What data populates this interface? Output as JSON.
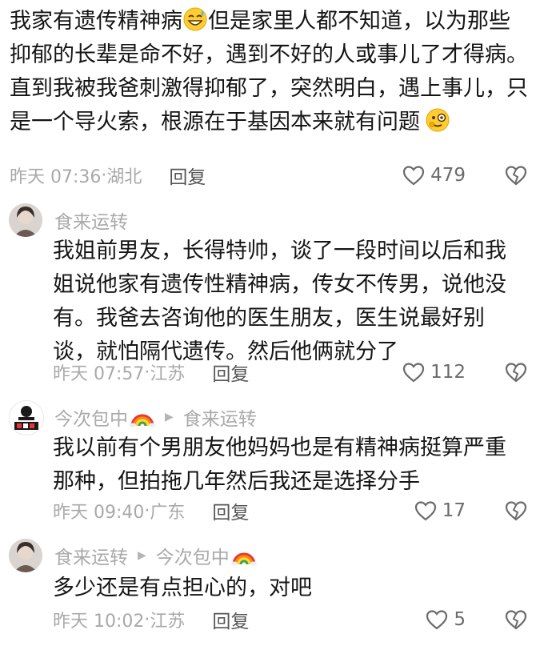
{
  "comments": [
    {
      "text_part1": "我家有遗传精神病",
      "text_part2": "但是家里人都不知道，以为那些抑郁的长辈是命不好，遇到不好的人或事儿了才得病。直到我被我爸刺激得抑郁了，突然明白，遇上事儿，只是一个导火索，根源在于基因本来就有问题",
      "emoji1": "sweat-smile-emoji",
      "emoji2": "monocle-emoji",
      "time": "昨天 07:36",
      "location": "湖北",
      "reply_label": "回复",
      "likes": "479"
    },
    {
      "author": "食来运转",
      "text": "我姐前男友，长得特帅，谈了一段时间以后和我姐说他家有遗传性精神病，传女不传男，说他没有。我爸去咨询他的医生朋友，医生说最好别谈，就怕隔代遗传。然后他俩就分了",
      "time": "昨天 07:57",
      "location": "江苏",
      "reply_label": "回复",
      "likes": "112"
    },
    {
      "author": "今次包中",
      "reply_to": "食来运转",
      "text": "我以前有个男朋友他妈妈也是有精神病挺算严重那种，但拍拖几年然后我还是选择分手",
      "time": "昨天 09:40",
      "location": "广东",
      "reply_label": "回复",
      "likes": "17"
    },
    {
      "author": "食来运转",
      "reply_to": "今次包中",
      "text": "多少还是有点担心的，对吧",
      "time": "昨天 10:02",
      "location": "江苏",
      "reply_label": "回复",
      "likes": "5"
    }
  ],
  "icons": {
    "like": "heart-outline-icon",
    "dislike": "broken-heart-icon",
    "reply_arrow": "triangle-right-icon",
    "rainbow": "rainbow-emoji"
  },
  "colors": {
    "meta_gray": "#a9a9a9",
    "body_text": "#151515",
    "reply_text": "#555555"
  }
}
